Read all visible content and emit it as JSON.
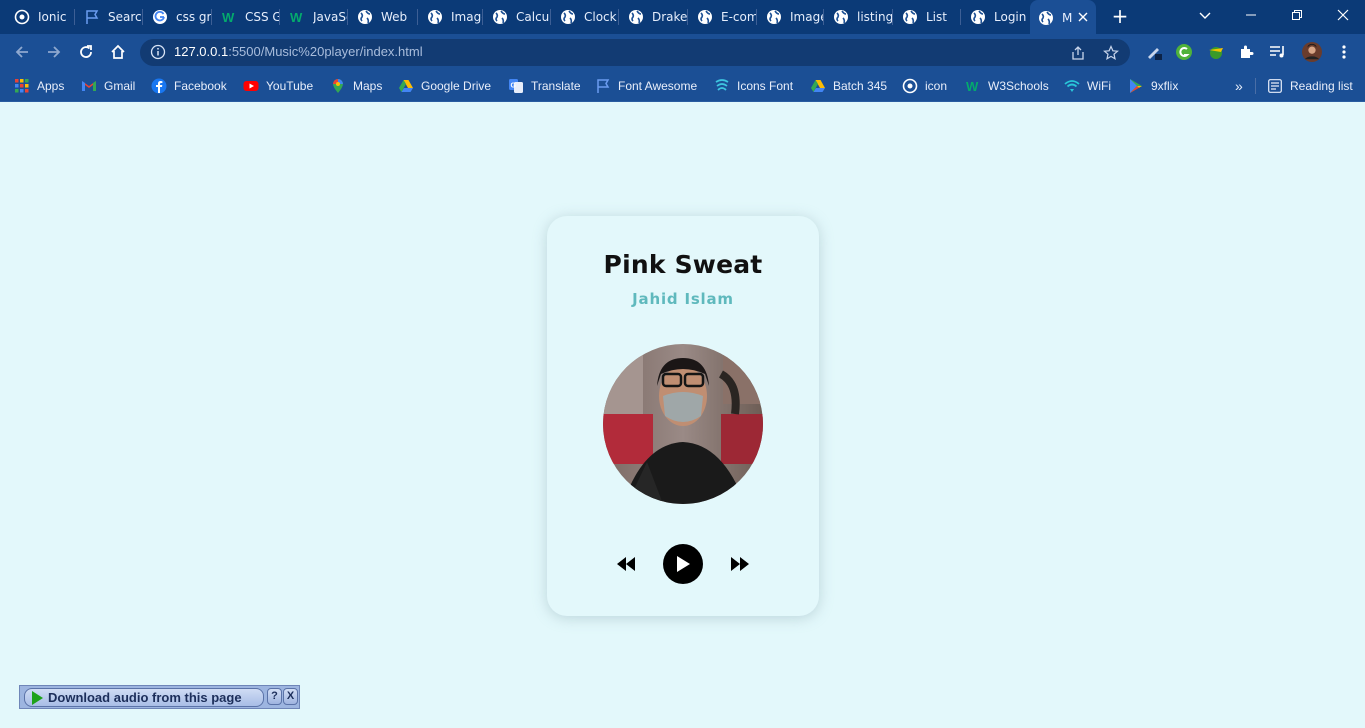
{
  "browser": {
    "tabs": [
      {
        "title": "Ionic",
        "icon": "ionic-icon"
      },
      {
        "title": "Search",
        "icon": "flag-icon"
      },
      {
        "title": "css grid",
        "icon": "google-icon"
      },
      {
        "title": "CSS Grid",
        "icon": "w3schools-icon"
      },
      {
        "title": "JavaScript",
        "icon": "w3schools-icon"
      },
      {
        "title": "Web",
        "icon": "globe-icon"
      },
      {
        "title": "Image",
        "icon": "globe-icon"
      },
      {
        "title": "Calculator",
        "icon": "globe-icon"
      },
      {
        "title": "Clock",
        "icon": "globe-icon"
      },
      {
        "title": "Drake",
        "icon": "globe-icon"
      },
      {
        "title": "E-commerce",
        "icon": "globe-icon"
      },
      {
        "title": "Image",
        "icon": "globe-icon"
      },
      {
        "title": "listing",
        "icon": "globe-icon"
      },
      {
        "title": "List",
        "icon": "globe-icon"
      },
      {
        "title": "Login",
        "icon": "globe-icon"
      },
      {
        "title": "Music",
        "icon": "globe-icon",
        "active": true
      }
    ],
    "url_host": "127.0.0.1",
    "url_path": ":5500/Music%20player/index.html",
    "bookmarks": [
      {
        "label": "Apps",
        "icon": "apps-grid-icon"
      },
      {
        "label": "Gmail",
        "icon": "gmail-icon"
      },
      {
        "label": "Facebook",
        "icon": "facebook-icon"
      },
      {
        "label": "YouTube",
        "icon": "youtube-icon"
      },
      {
        "label": "Maps",
        "icon": "maps-icon"
      },
      {
        "label": "Google Drive",
        "icon": "drive-icon"
      },
      {
        "label": "Translate",
        "icon": "translate-icon"
      },
      {
        "label": "Font Awesome",
        "icon": "flag-icon"
      },
      {
        "label": "Icons Font",
        "icon": "icons-font-icon"
      },
      {
        "label": "Batch 345",
        "icon": "drive-icon"
      },
      {
        "label": "icon",
        "icon": "ionic-icon"
      },
      {
        "label": "W3Schools",
        "icon": "w3schools-icon"
      },
      {
        "label": "WiFi",
        "icon": "wifi-icon"
      },
      {
        "label": "9xflix",
        "icon": "play-store-icon"
      }
    ],
    "reading_list": "Reading list",
    "overflow": "»"
  },
  "player": {
    "song_title": "Pink Sweat",
    "artist": "Jahid Islam",
    "controls": {
      "prev": "backward-icon",
      "play": "play-icon",
      "next": "forward-icon"
    }
  },
  "download_bar": {
    "label": "Download audio from this page",
    "help": "?",
    "close": "X"
  },
  "colors": {
    "page_bg": "#e3f8fb",
    "chrome_dark": "#0b3a77",
    "chrome_toolbar": "#1b4f95",
    "artist_accent": "#5fb9bd"
  }
}
